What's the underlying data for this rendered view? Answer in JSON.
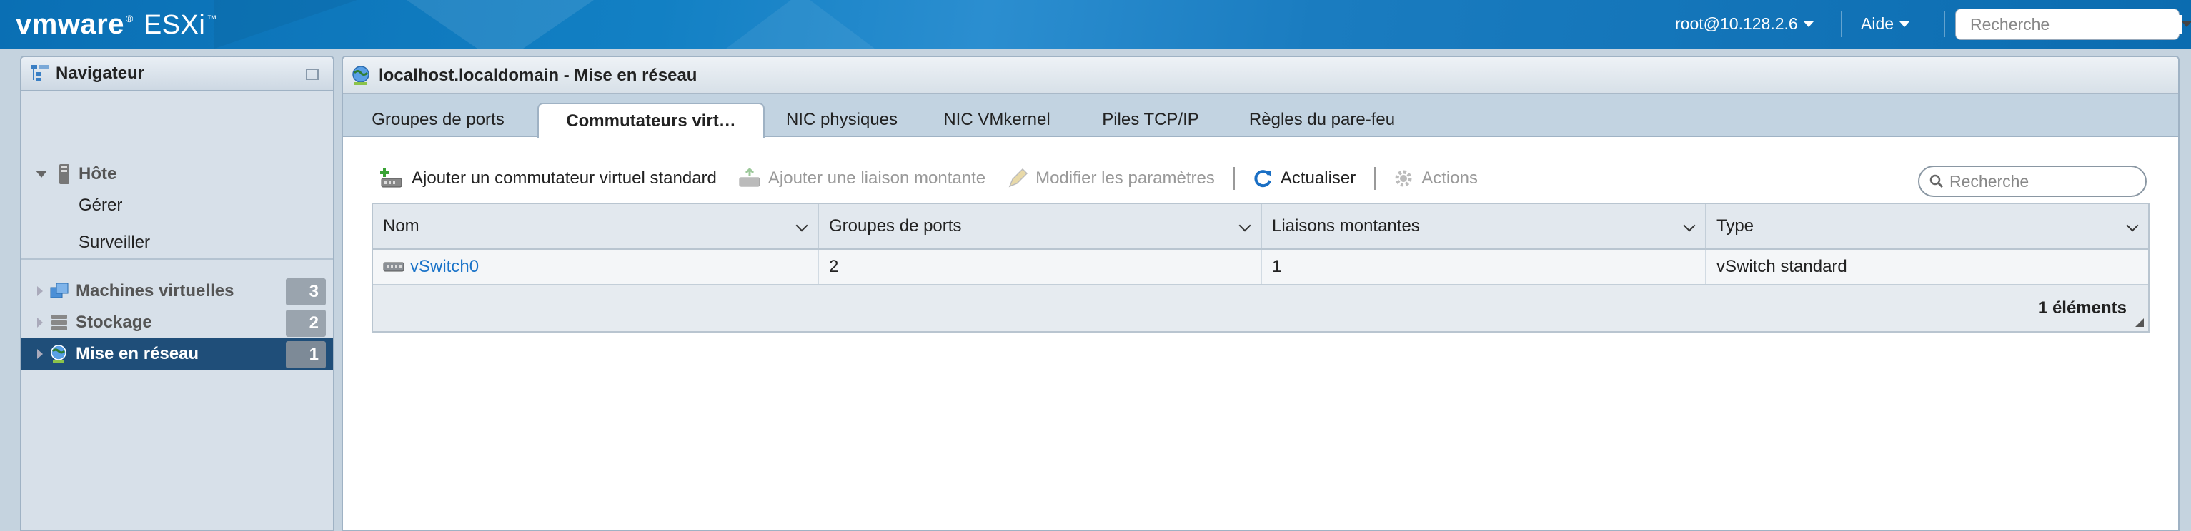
{
  "header": {
    "brand_vm": "vmware",
    "brand_product": "ESXi",
    "user": "root@10.128.2.6",
    "help": "Aide",
    "search_placeholder": "Recherche"
  },
  "navigator": {
    "title": "Navigateur",
    "host": {
      "label": "Hôte",
      "children": [
        "Gérer",
        "Surveiller"
      ]
    },
    "items": [
      {
        "label": "Machines virtuelles",
        "count": "3"
      },
      {
        "label": "Stockage",
        "count": "2"
      },
      {
        "label": "Mise en réseau",
        "count": "1",
        "selected": true
      }
    ]
  },
  "main": {
    "title": "localhost.localdomain - Mise en réseau",
    "tabs": [
      {
        "label": "Groupes de ports"
      },
      {
        "label": "Commutateurs virt…",
        "active": true
      },
      {
        "label": "NIC physiques"
      },
      {
        "label": "NIC VMkernel"
      },
      {
        "label": "Piles TCP/IP"
      },
      {
        "label": "Règles du pare-feu"
      }
    ],
    "toolbar": {
      "add_switch": "Ajouter un commutateur virtuel standard",
      "add_uplink": "Ajouter une liaison montante",
      "edit_settings": "Modifier les paramètres",
      "refresh": "Actualiser",
      "actions": "Actions",
      "search_placeholder": "Recherche"
    },
    "table": {
      "columns": [
        "Nom",
        "Groupes de ports",
        "Liaisons montantes",
        "Type"
      ],
      "rows": [
        {
          "name": "vSwitch0",
          "port_groups": "2",
          "uplinks": "1",
          "type": "vSwitch standard"
        }
      ],
      "footer": "1 éléments"
    }
  },
  "colors": {
    "header_blue": "#0a6fb4",
    "nav_selected": "#1f4e79",
    "link": "#1a73c8"
  }
}
